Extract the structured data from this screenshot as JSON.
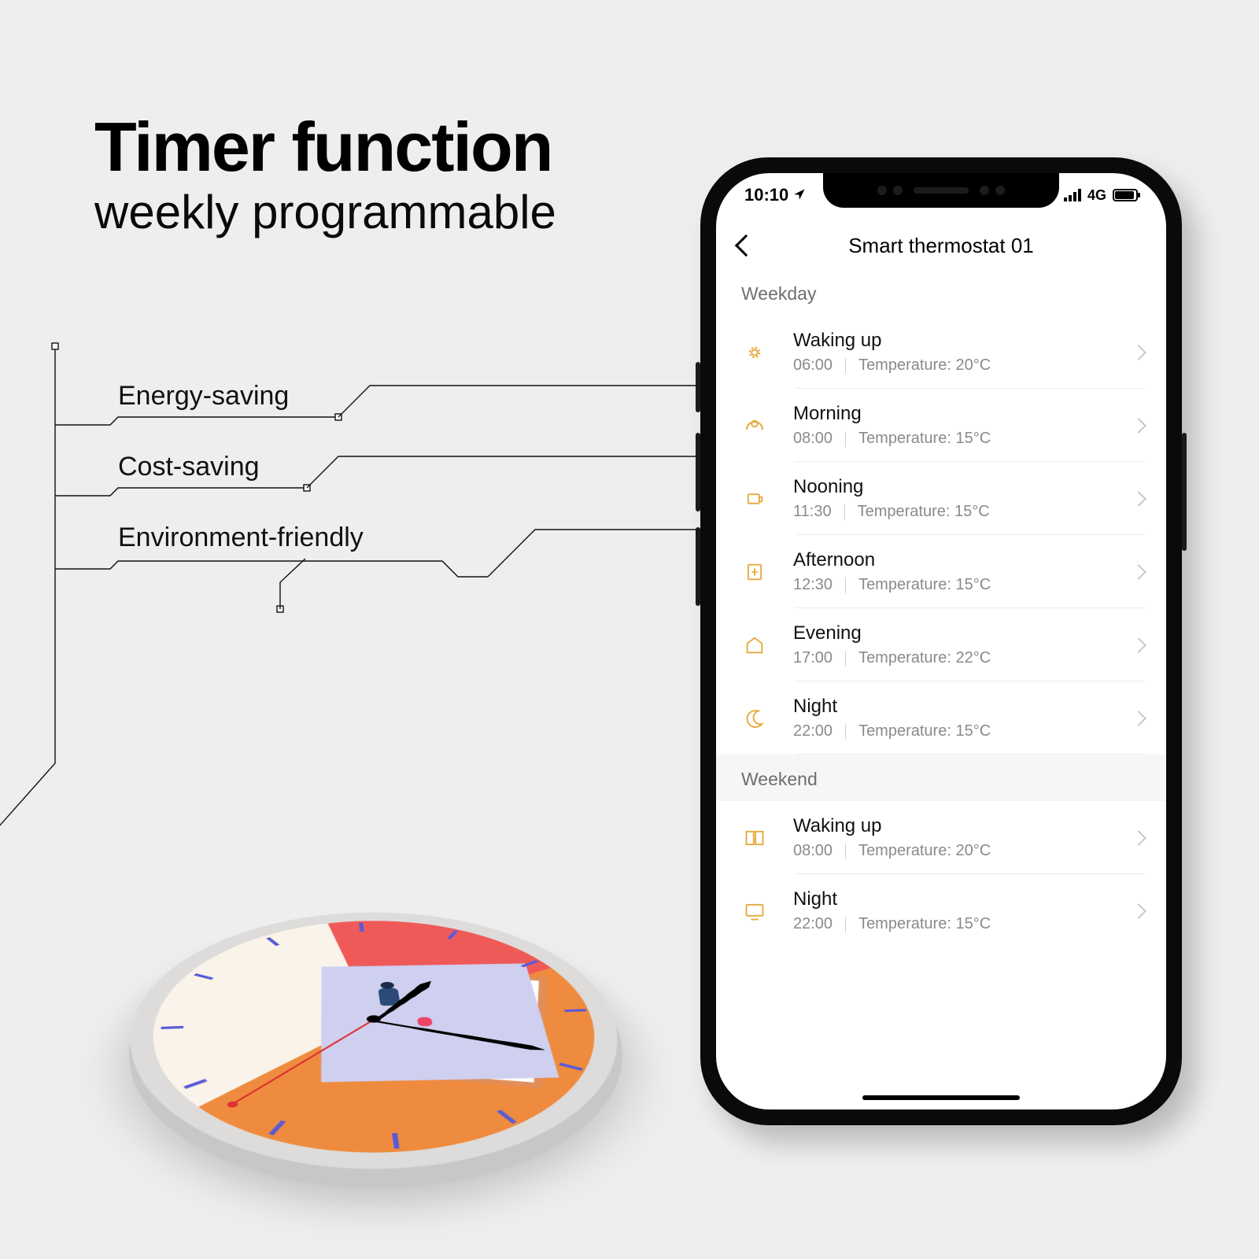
{
  "headline": {
    "title": "Timer function",
    "subtitle": "weekly programmable"
  },
  "features": {
    "items": [
      "Energy-saving",
      "Cost-saving",
      "Environment-friendly"
    ]
  },
  "phone": {
    "status": {
      "time": "10:10",
      "network": "4G"
    },
    "nav": {
      "title": "Smart thermostat 01"
    },
    "sections": [
      {
        "header": "Weekday",
        "rows": [
          {
            "icon": "sunrise-icon",
            "label": "Waking up",
            "time": "06:00",
            "temp": "Temperature: 20°C"
          },
          {
            "icon": "morning-icon",
            "label": "Morning",
            "time": "08:00",
            "temp": "Temperature: 15°C"
          },
          {
            "icon": "noon-icon",
            "label": "Nooning",
            "time": "11:30",
            "temp": "Temperature: 15°C"
          },
          {
            "icon": "afternoon-icon",
            "label": "Afternoon",
            "time": "12:30",
            "temp": "Temperature: 15°C"
          },
          {
            "icon": "evening-icon",
            "label": "Evening",
            "time": "17:00",
            "temp": "Temperature: 22°C"
          },
          {
            "icon": "night-icon",
            "label": "Night",
            "time": "22:00",
            "temp": "Temperature: 15°C"
          }
        ]
      },
      {
        "header": "Weekend",
        "rows": [
          {
            "icon": "book-icon",
            "label": "Waking up",
            "time": "08:00",
            "temp": "Temperature: 20°C"
          },
          {
            "icon": "tv-icon",
            "label": "Night",
            "time": "22:00",
            "temp": "Temperature: 15°C"
          }
        ]
      }
    ]
  }
}
